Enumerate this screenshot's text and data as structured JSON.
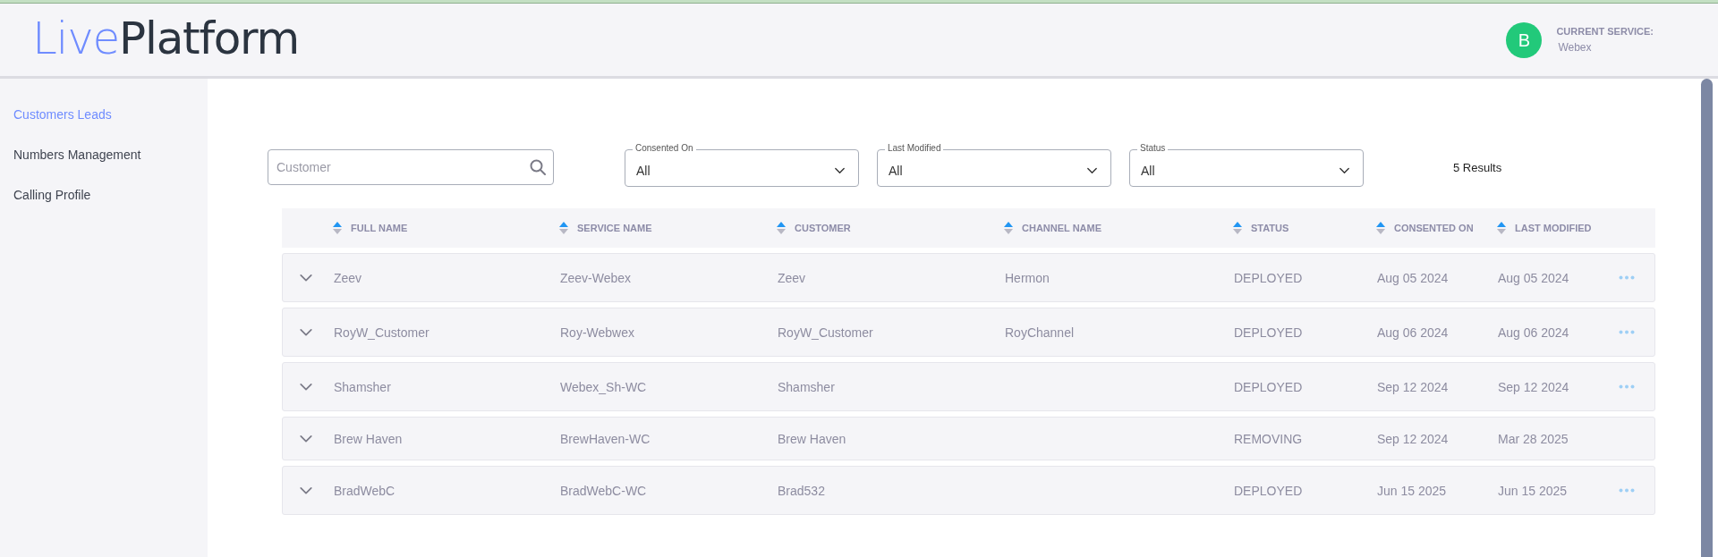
{
  "logo": {
    "part_1": "Live",
    "part_2": "Platform"
  },
  "current_service": {
    "avatar": "B",
    "label": "CURRENT SERVICE:",
    "value": "Webex"
  },
  "sidebar": {
    "items": [
      {
        "label": "Customers Leads",
        "selected": true
      },
      {
        "label": "Numbers Management",
        "selected": false
      },
      {
        "label": "Calling Profile",
        "selected": false
      }
    ]
  },
  "filters": {
    "search": {
      "placeholder": "Customer"
    },
    "dropdowns": [
      {
        "label": "Consented On",
        "value": "All"
      },
      {
        "label": "Last Modified",
        "value": "All"
      },
      {
        "label": "Status",
        "value": "All"
      }
    ],
    "results": "5 Results"
  },
  "table": {
    "columns": [
      "FULL NAME",
      "SERVICE NAME",
      "CUSTOMER",
      "CHANNEL NAME",
      "STATUS",
      "CONSENTED ON",
      "LAST MODIFIED"
    ],
    "rows": [
      {
        "cells": [
          "Zeev",
          "Zeev-Webex",
          "Zeev",
          "Hermon",
          "DEPLOYED",
          "Aug 05 2024",
          "Aug 05 2024"
        ],
        "has_menu": true
      },
      {
        "cells": [
          "RoyW_Customer",
          "Roy-Webwex",
          "RoyW_Customer",
          "RoyChannel",
          "DEPLOYED",
          "Aug 06 2024",
          "Aug 06 2024"
        ],
        "has_menu": true
      },
      {
        "cells": [
          "Shamsher",
          "Webex_Sh-WC",
          "Shamsher",
          "",
          "DEPLOYED",
          "Sep 12 2024",
          "Sep 12 2024"
        ],
        "has_menu": true
      },
      {
        "cells": [
          "Brew Haven",
          "BrewHaven-WC",
          "Brew Haven",
          "",
          "REMOVING",
          "Sep 12 2024",
          "Mar 28 2025"
        ],
        "has_menu": false
      },
      {
        "cells": [
          "BradWebC",
          "BradWebC-WC",
          "Brad532",
          "",
          "DEPLOYED",
          "Jun 15 2025",
          "Jun 15 2025"
        ],
        "has_menu": true
      }
    ]
  }
}
